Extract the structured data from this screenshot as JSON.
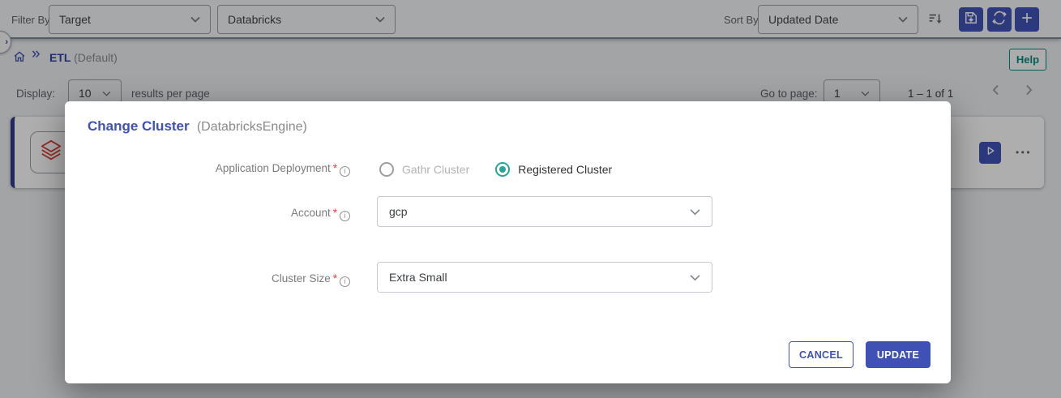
{
  "colors": {
    "accent_indigo": "#3f51b5",
    "teal": "#00897b",
    "radio_selected_teal": "#26a69a",
    "required_red": "#e53935",
    "databricks_red": "#d93b2e"
  },
  "filter_bar": {
    "filter_by_label": "Filter By",
    "filter_target_value": "Target",
    "filter_engine_value": "Databricks",
    "sort_by_label": "Sort By",
    "sort_value": "Updated Date"
  },
  "breadcrumb": {
    "separator": "»",
    "item": "ETL",
    "item_suffix": "(Default)",
    "help_label": "Help"
  },
  "pagination": {
    "display_label": "Display:",
    "page_size_value": "10",
    "results_label": "results per page",
    "goto_label": "Go to page:",
    "page_value": "1",
    "range_text": "1 – 1 of 1"
  },
  "modal": {
    "title": "Change Cluster",
    "subtitle": "(DatabricksEngine)",
    "fields": [
      {
        "label": "Application Deployment",
        "required": "*",
        "options": [
          {
            "label": "Gathr Cluster"
          },
          {
            "label": "Registered Cluster"
          }
        ]
      },
      {
        "label": "Account",
        "required": "*",
        "value": "gcp"
      },
      {
        "label": "Cluster Size",
        "required": "*",
        "value": "Extra Small"
      }
    ],
    "cancel_label": "CANCEL",
    "update_label": "UPDATE"
  }
}
